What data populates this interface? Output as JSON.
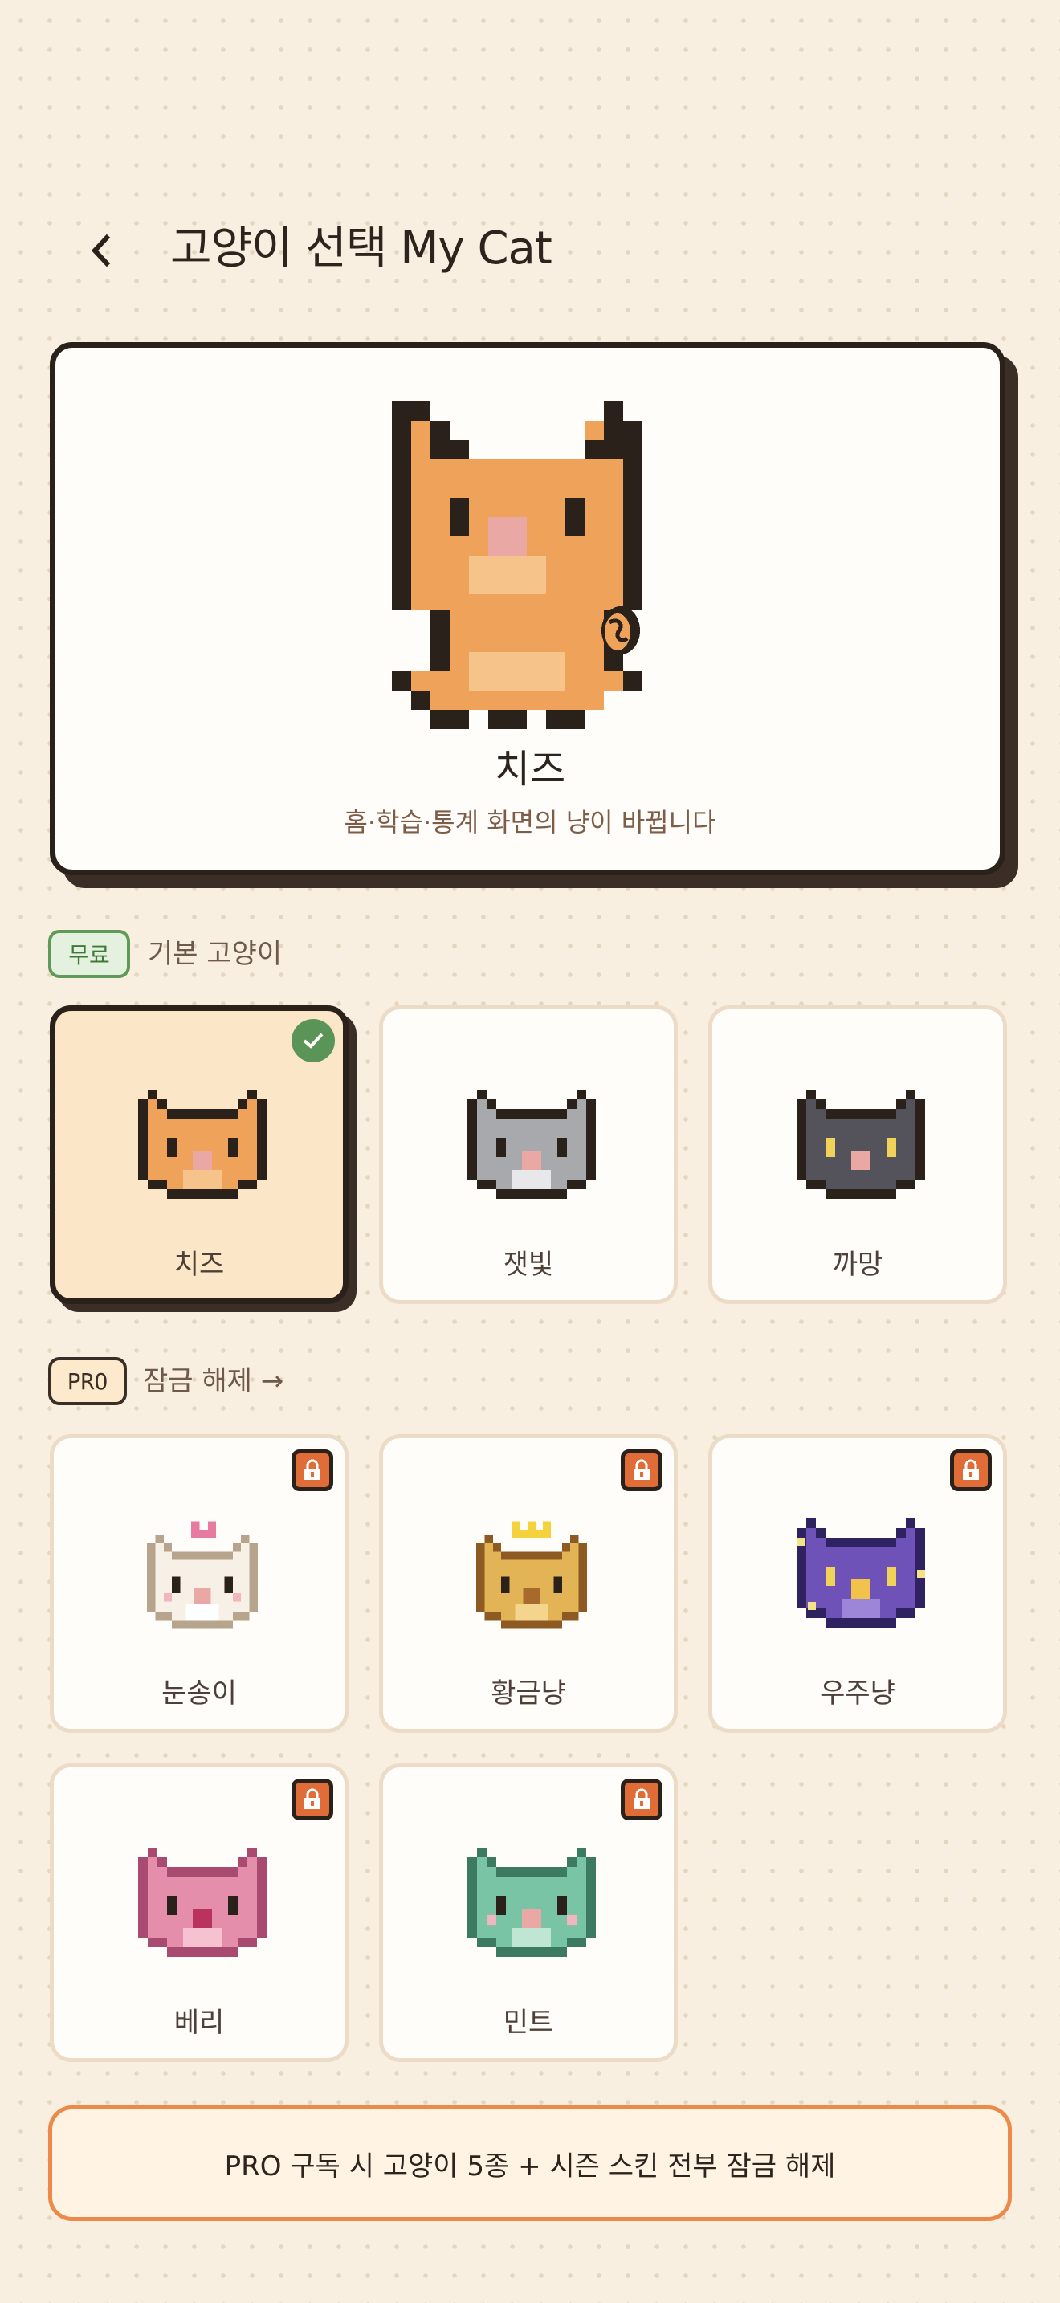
{
  "header": {
    "back_icon": "chevron-left-icon",
    "title": "고양이 선택 My Cat"
  },
  "hero": {
    "name": "치즈",
    "subtitle": "홈·학습·통계 화면의 냥이 바뀝니다"
  },
  "free_section": {
    "badge": "무료",
    "label": "기본 고양이",
    "cats": [
      {
        "name": "치즈",
        "selected": true,
        "color": "#f0a157"
      },
      {
        "name": "잿빛",
        "selected": false,
        "color": "#a7a9ad"
      },
      {
        "name": "까망",
        "selected": false,
        "color": "#54535c"
      }
    ]
  },
  "pro_section": {
    "badge": "PRO",
    "label": "잠금 해제 →",
    "cats": [
      {
        "name": "눈송이",
        "locked": true,
        "color": "#f6f0e6"
      },
      {
        "name": "황금냥",
        "locked": true,
        "color": "#e2b455"
      },
      {
        "name": "우주냥",
        "locked": true,
        "color": "#6e52b8"
      },
      {
        "name": "베리",
        "locked": true,
        "color": "#e48eac"
      },
      {
        "name": "민트",
        "locked": true,
        "color": "#78c4a4"
      }
    ]
  },
  "banner": {
    "text": "PRO 구독 시 고양이 5종 + 시즌 스킨 전부 잠금 해제"
  }
}
